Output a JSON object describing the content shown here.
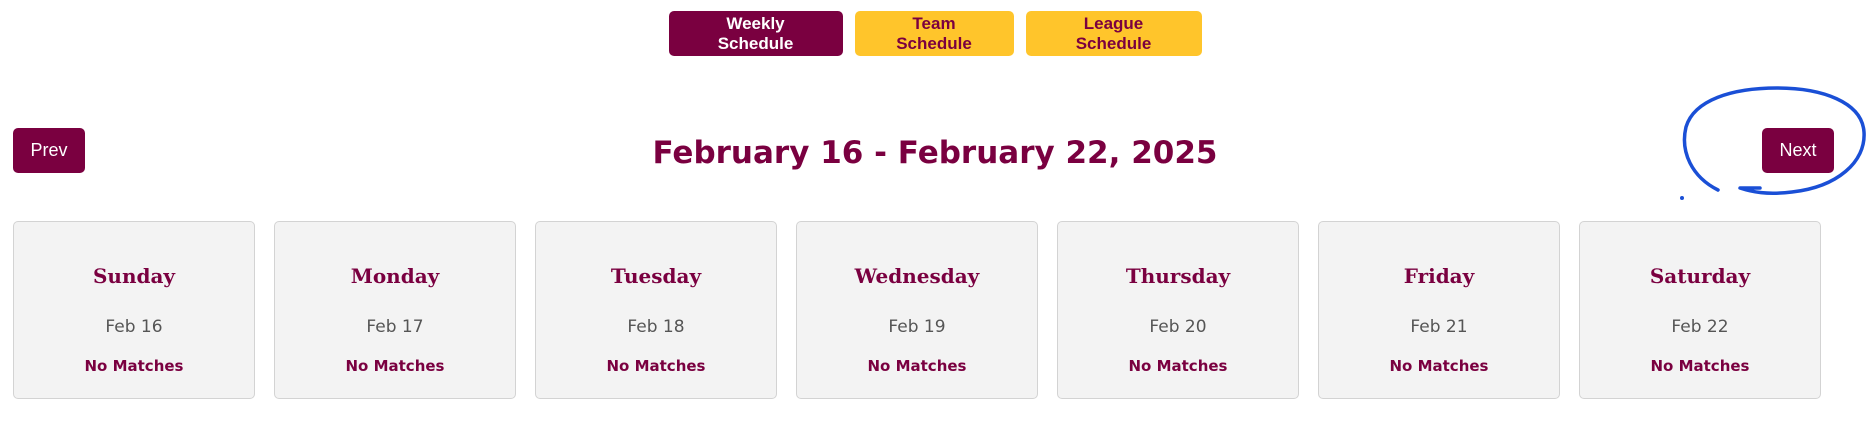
{
  "tabs": [
    {
      "label": "Weekly Schedule",
      "active": true
    },
    {
      "label": "Team Schedule",
      "active": false
    },
    {
      "label": "League Schedule",
      "active": false
    }
  ],
  "nav": {
    "prev_label": "Prev",
    "next_label": "Next",
    "week_title": "February 16 - February 22, 2025"
  },
  "days": [
    {
      "name": "Sunday",
      "date": "Feb 16",
      "status": "No Matches"
    },
    {
      "name": "Monday",
      "date": "Feb 17",
      "status": "No Matches"
    },
    {
      "name": "Tuesday",
      "date": "Feb 18",
      "status": "No Matches"
    },
    {
      "name": "Wednesday",
      "date": "Feb 19",
      "status": "No Matches"
    },
    {
      "name": "Thursday",
      "date": "Feb 20",
      "status": "No Matches"
    },
    {
      "name": "Friday",
      "date": "Feb 21",
      "status": "No Matches"
    },
    {
      "name": "Saturday",
      "date": "Feb 22",
      "status": "No Matches"
    }
  ],
  "colors": {
    "primary": "#7a0040",
    "accent": "#ffc52b",
    "card_bg": "#f3f3f3",
    "annotation": "#1a4fd6"
  }
}
